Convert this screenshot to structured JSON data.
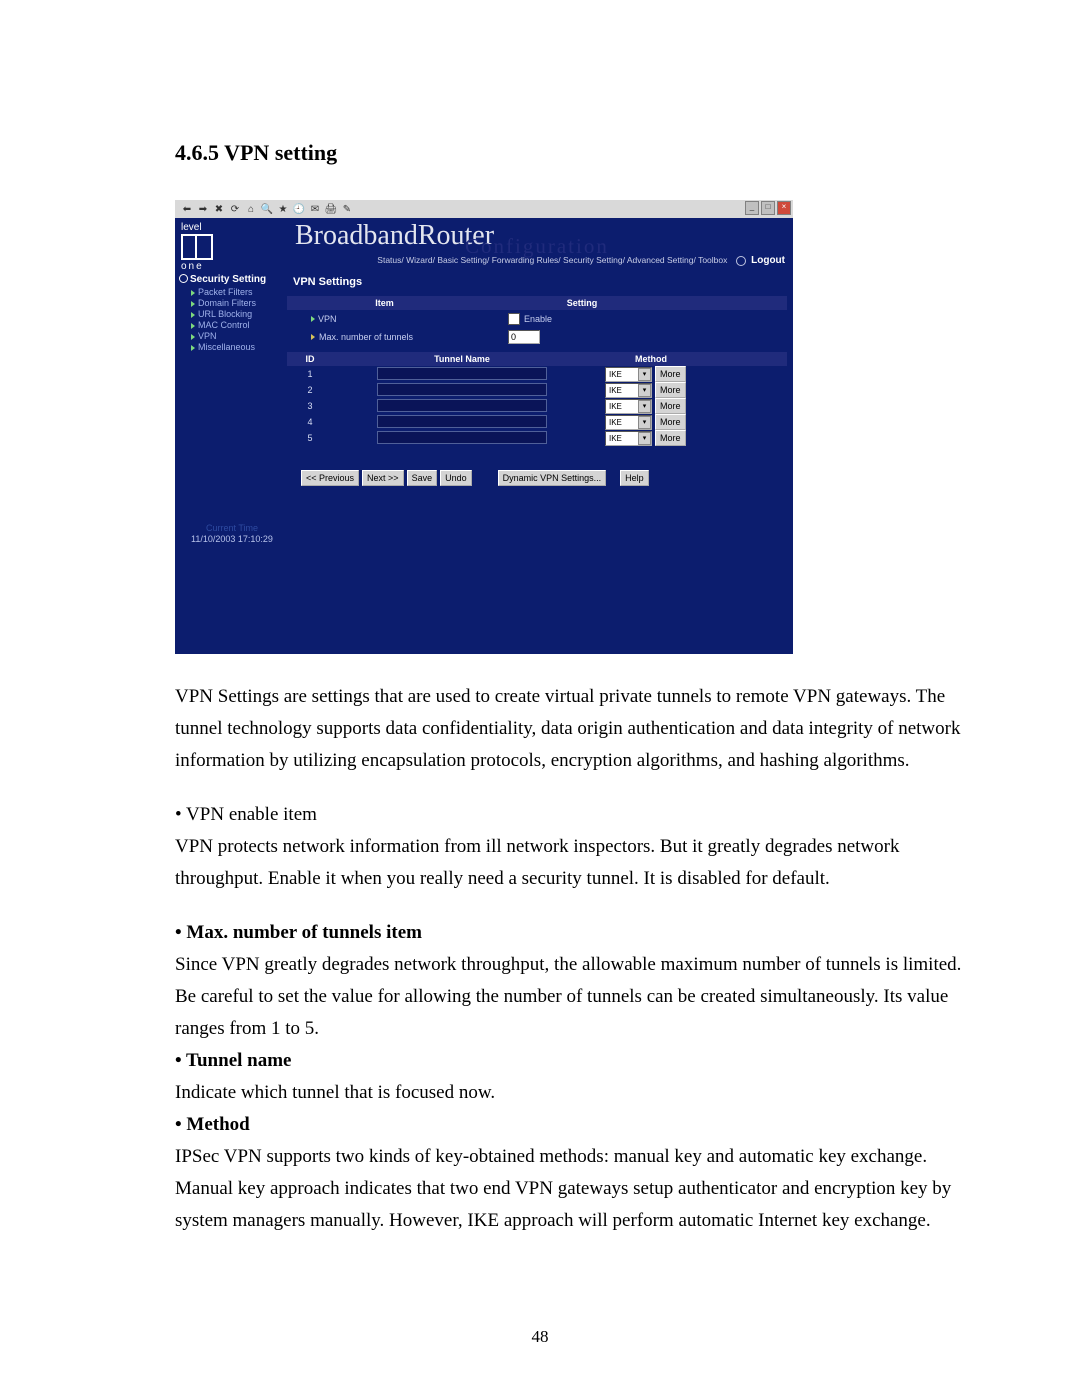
{
  "doc": {
    "section_title": "4.6.5 VPN setting",
    "page_number": "48",
    "para1": "VPN Settings are settings that are used to create virtual private tunnels to remote VPN gateways. The tunnel technology supports data confidentiality, data origin authentication and data integrity of network information by utilizing encapsulation protocols, encryption algorithms, and hashing algorithms.",
    "bullet1_title": "• VPN enable item",
    "bullet1_text": "VPN protects network information from ill network inspectors. But it greatly degrades network throughput. Enable it when you really need a security tunnel. It is disabled for default.",
    "bullet2_title": "• Max. number of tunnels item",
    "bullet2_text": "Since VPN greatly degrades network throughput, the allowable maximum number of tunnels is limited. Be careful to set the value for allowing the number of tunnels can be created simultaneously. Its value ranges from 1 to 5.",
    "bullet3_title": "• Tunnel name",
    "bullet3_text": "Indicate which tunnel that is focused now.",
    "bullet4_title": "• Method",
    "bullet4_text": "IPSec VPN supports two kinds of key-obtained methods: manual key and automatic key exchange. Manual key approach indicates that two end VPN gateways setup authenticator and encryption key by system managers manually. However, IKE approach will perform automatic Internet key exchange."
  },
  "router": {
    "brand_title": "BroadbandRouter",
    "brand_sub": "Configuration",
    "logo_line1": "level",
    "logo_line2": "one",
    "topnav": {
      "status": "Status/",
      "wizard": "Wizard/",
      "basic": "Basic Setting/",
      "forwarding": "Forwarding Rules/",
      "security": "Security Setting/",
      "advanced": "Advanced Setting/",
      "toolbox": "Toolbox",
      "logout": "Logout"
    },
    "sidebar": {
      "section": "Security Setting",
      "items": [
        "Packet Filters",
        "Domain Filters",
        "URL Blocking",
        "MAC Control",
        "VPN",
        "Miscellaneous"
      ],
      "time_label": "Current Time",
      "time_value": "11/10/2003 17:10:29"
    },
    "panel_title": "VPN Settings",
    "headers": {
      "item": "Item",
      "setting": "Setting",
      "id": "ID",
      "tunnel_name": "Tunnel Name",
      "method": "Method"
    },
    "vpn_row": {
      "label": "VPN",
      "enable": "Enable"
    },
    "max_row": {
      "label": "Max. number of tunnels",
      "value": "0"
    },
    "tunnels": [
      {
        "id": "1",
        "method": "IKE",
        "more": "More"
      },
      {
        "id": "2",
        "method": "IKE",
        "more": "More"
      },
      {
        "id": "3",
        "method": "IKE",
        "more": "More"
      },
      {
        "id": "4",
        "method": "IKE",
        "more": "More"
      },
      {
        "id": "5",
        "method": "IKE",
        "more": "More"
      }
    ],
    "buttons": {
      "prev": "<< Previous",
      "next": "Next >>",
      "save": "Save",
      "undo": "Undo",
      "dyn": "Dynamic VPN Settings...",
      "help": "Help"
    }
  }
}
